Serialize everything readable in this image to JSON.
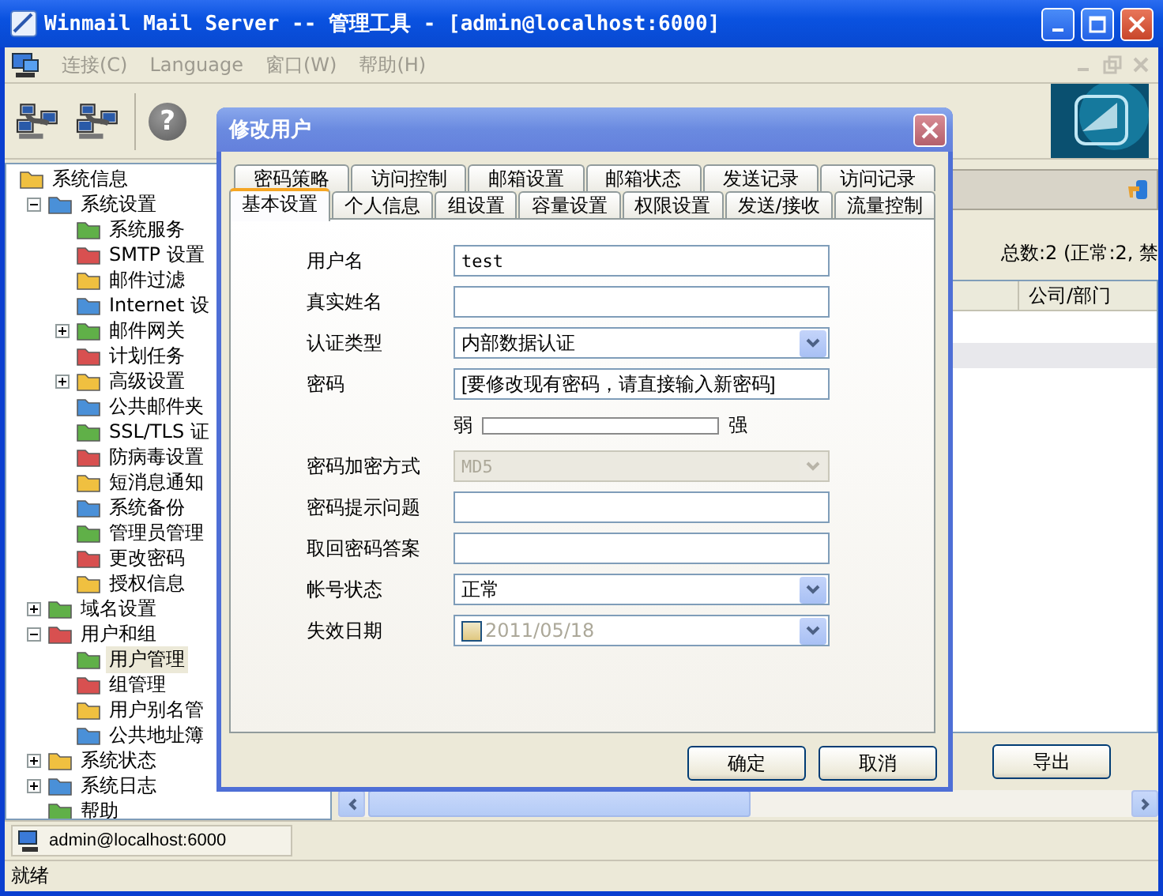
{
  "window": {
    "title": "Winmail Mail Server -- 管理工具 - [admin@localhost:6000]"
  },
  "menu": [
    {
      "label": "连接(C)",
      "disabled": true
    },
    {
      "label": "Language",
      "disabled": true
    },
    {
      "label": "窗口(W)",
      "disabled": true
    },
    {
      "label": "帮助(H)",
      "disabled": true
    }
  ],
  "toolbar": {
    "help_glyph": "?"
  },
  "tree": [
    {
      "label": "系统信息",
      "selected": false,
      "children": [
        {
          "label": "系统设置",
          "selected": false,
          "expanded": true,
          "children": [
            {
              "label": "系统服务",
              "selected": false
            },
            {
              "label": "SMTP 设置",
              "selected": false
            },
            {
              "label": "邮件过滤",
              "selected": false
            },
            {
              "label": "Internet 设",
              "selected": false
            },
            {
              "label": "邮件网关",
              "selected": false,
              "expanded": false
            },
            {
              "label": "计划任务",
              "selected": false
            },
            {
              "label": "高级设置",
              "selected": false,
              "expanded": false
            },
            {
              "label": "公共邮件夹",
              "selected": false
            },
            {
              "label": "SSL/TLS 证",
              "selected": false
            },
            {
              "label": "防病毒设置",
              "selected": false
            },
            {
              "label": "短消息通知",
              "selected": false
            },
            {
              "label": "系统备份",
              "selected": false
            },
            {
              "label": "管理员管理",
              "selected": false
            },
            {
              "label": "更改密码",
              "selected": false
            },
            {
              "label": "授权信息",
              "selected": false
            }
          ]
        },
        {
          "label": "域名设置",
          "selected": false,
          "expanded": false
        },
        {
          "label": "用户和组",
          "selected": false,
          "expanded": true,
          "children": [
            {
              "label": "用户管理",
              "selected": true
            },
            {
              "label": "组管理",
              "selected": false
            },
            {
              "label": "用户别名管",
              "selected": false
            },
            {
              "label": "公共地址簿",
              "selected": false
            }
          ]
        },
        {
          "label": "系统状态",
          "selected": false,
          "expanded": false
        },
        {
          "label": "系统日志",
          "selected": false,
          "expanded": false
        },
        {
          "label": "帮助",
          "selected": false
        }
      ]
    }
  ],
  "right_pane": {
    "summary": "总数:2 (正常:2, 禁",
    "columns": [
      "公司/部门"
    ],
    "rows": [
      {
        "selected": false
      },
      {
        "selected": true
      }
    ],
    "buttons": [
      "导出"
    ]
  },
  "sessions": [
    {
      "label": "admin@localhost:6000"
    }
  ],
  "status_bar": "就绪",
  "dialog": {
    "title": "修改用户",
    "tab_rows": [
      [
        {
          "label": "密码策略",
          "selected": false
        },
        {
          "label": "访问控制",
          "selected": false
        },
        {
          "label": "邮箱设置",
          "selected": false
        },
        {
          "label": "邮箱状态",
          "selected": false
        },
        {
          "label": "发送记录",
          "selected": false
        },
        {
          "label": "访问记录",
          "selected": false
        }
      ],
      [
        {
          "label": "基本设置",
          "selected": true
        },
        {
          "label": "个人信息",
          "selected": false
        },
        {
          "label": "组设置",
          "selected": false
        },
        {
          "label": "容量设置",
          "selected": false
        },
        {
          "label": "权限设置",
          "selected": false
        },
        {
          "label": "发送/接收",
          "selected": false
        },
        {
          "label": "流量控制",
          "selected": false
        }
      ]
    ],
    "fields": [
      {
        "kind": "text",
        "label": "用户名",
        "value": "test"
      },
      {
        "kind": "text",
        "label": "真实姓名"
      },
      {
        "kind": "select",
        "label": "认证类型",
        "value": "内部数据认证",
        "disabled": false
      },
      {
        "kind": "text",
        "label": "密码",
        "value": "[要修改现有密码，请直接输入新密码]"
      },
      {
        "kind": "strength",
        "weak": "弱",
        "strong": "强",
        "level": 0
      },
      {
        "kind": "select",
        "label": "密码加密方式",
        "value": "MD5",
        "disabled": true
      },
      {
        "kind": "text",
        "label": "密码提示问题"
      },
      {
        "kind": "text",
        "label": "取回密码答案"
      },
      {
        "kind": "select",
        "label": "帐号状态",
        "value": "正常",
        "disabled": false
      },
      {
        "kind": "date",
        "label": "失效日期",
        "value": "2011/05/18",
        "checked": false
      }
    ],
    "buttons": [
      "确定",
      "取消"
    ]
  }
}
